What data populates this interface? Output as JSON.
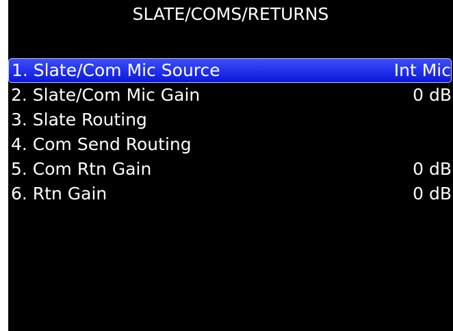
{
  "screen": {
    "title": "SLATE/COMS/RETURNS"
  },
  "menu": {
    "selected_index": 0,
    "items": [
      {
        "label": "1. Slate/Com Mic Source",
        "value": "Int Mic"
      },
      {
        "label": "2. Slate/Com Mic Gain",
        "value": "0 dB"
      },
      {
        "label": "3. Slate Routing",
        "value": ""
      },
      {
        "label": "4. Com Send Routing",
        "value": ""
      },
      {
        "label": "5. Com Rtn Gain",
        "value": "0 dB"
      },
      {
        "label": "6. Rtn Gain",
        "value": "0 dB"
      }
    ]
  },
  "colors": {
    "background": "#000000",
    "text": "#ffffff",
    "selection": "#1f2cf0"
  }
}
